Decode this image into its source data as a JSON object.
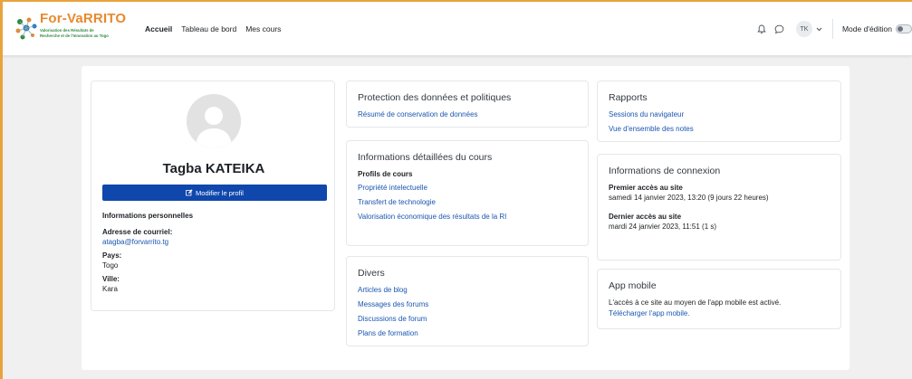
{
  "branding": {
    "logo_title": "For-VaRRITO",
    "logo_subtitle_line1": "Valorisation des Résultats de",
    "logo_subtitle_line2": "Recherche et de l'Innovation au Togo"
  },
  "nav": {
    "links": [
      "Accueil",
      "Tableau de bord",
      "Mes cours"
    ],
    "active": "Accueil",
    "user_initials": "TK",
    "edit_mode_label": "Mode d'édition"
  },
  "profile": {
    "name": "Tagba KATEIKA",
    "edit_button_label": "Modifier le profil",
    "section_title": "Informations personnelles",
    "email_label": "Adresse de courriel:",
    "email_value": "atagba@forvarrito.tg",
    "country_label": "Pays:",
    "country_value": "Togo",
    "city_label": "Ville:",
    "city_value": "Kara"
  },
  "privacy": {
    "title": "Protection des données et politiques",
    "links": [
      "Résumé de conservation de données"
    ]
  },
  "course_details": {
    "title": "Informations détaillées du cours",
    "subtitle": "Profils de cours",
    "links": [
      "Propriété intelectuelle",
      "Transfert de technologie",
      "Valorisation économique des résultats de la RI"
    ]
  },
  "misc": {
    "title": "Divers",
    "links": [
      "Articles de blog",
      "Messages des forums",
      "Discussions de forum",
      "Plans de formation"
    ]
  },
  "reports": {
    "title": "Rapports",
    "links": [
      "Sessions du navigateur",
      "Vue d'ensemble des notes"
    ]
  },
  "login_info": {
    "title": "Informations de connexion",
    "first_access_label": "Premier accès au site",
    "first_access_value": "samedi 14 janvier 2023, 13:20  (9 jours 22 heures)",
    "last_access_label": "Dernier accès au site",
    "last_access_value": "mardi 24 janvier 2023, 11:51  (1 s)"
  },
  "mobile_app": {
    "title": "App mobile",
    "text": "L'accès à ce site au moyen de l'app mobile est activé.",
    "link": "Télécharger l'app mobile."
  },
  "colors": {
    "primary": "#0f47ad",
    "link": "#1a56b0",
    "logo_orange": "#e8892d",
    "logo_green": "#2f8a3e",
    "frame_orange": "#e8a33d"
  },
  "icons": [
    "bell-icon",
    "chat-icon",
    "chevron-down-icon",
    "pencil-icon",
    "default-avatar-icon"
  ]
}
